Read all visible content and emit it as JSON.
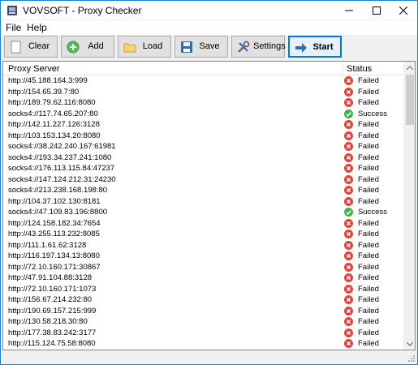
{
  "window": {
    "title": "VOVSOFT - Proxy Checker"
  },
  "menu": {
    "items": [
      "File",
      "Help"
    ]
  },
  "toolbar": {
    "clear_label": "Clear",
    "add_label": "Add",
    "load_label": "Load",
    "save_label": "Save",
    "settings_label": "Settings",
    "start_label": "Start"
  },
  "grid": {
    "headers": {
      "proxy": "Proxy Server",
      "status": "Status"
    },
    "rows": [
      {
        "proxy": "http://45.188.164.3:999",
        "status": "Failed"
      },
      {
        "proxy": "http://154.65.39.7:80",
        "status": "Failed"
      },
      {
        "proxy": "http://189.79.62.116:8080",
        "status": "Failed"
      },
      {
        "proxy": "socks4://117.74.65.207:80",
        "status": "Success"
      },
      {
        "proxy": "http://142.11.227.126:3128",
        "status": "Failed"
      },
      {
        "proxy": "http://103.153.134.20:8080",
        "status": "Failed"
      },
      {
        "proxy": "socks4://38.242.240.167:61981",
        "status": "Failed"
      },
      {
        "proxy": "socks4://193.34.237.241:1080",
        "status": "Failed"
      },
      {
        "proxy": "socks4://176.113.115.84:47237",
        "status": "Failed"
      },
      {
        "proxy": "socks4://147.124.212.31:24230",
        "status": "Failed"
      },
      {
        "proxy": "socks4://213.238.168.198:80",
        "status": "Failed"
      },
      {
        "proxy": "http://104.37.102.130:8181",
        "status": "Failed"
      },
      {
        "proxy": "socks4://47.109.83.196:8800",
        "status": "Success"
      },
      {
        "proxy": "http://124.158.182.34:7654",
        "status": "Failed"
      },
      {
        "proxy": "http://43.255.113.232:8085",
        "status": "Failed"
      },
      {
        "proxy": "http://111.1.61.62:3128",
        "status": "Failed"
      },
      {
        "proxy": "http://116.197.134.13:8080",
        "status": "Failed"
      },
      {
        "proxy": "http://72.10.160.171:30867",
        "status": "Failed"
      },
      {
        "proxy": "http://47.91.104.88:3128",
        "status": "Failed"
      },
      {
        "proxy": "http://72.10.160.171:1073",
        "status": "Failed"
      },
      {
        "proxy": "http://156.67.214.232:80",
        "status": "Failed"
      },
      {
        "proxy": "http://190.69.157.215:999",
        "status": "Failed"
      },
      {
        "proxy": "http://130.58.218.30:80",
        "status": "Failed"
      },
      {
        "proxy": "http://177.38.83.242:3177",
        "status": "Failed"
      },
      {
        "proxy": "http://115.124.75.58:8080",
        "status": "Failed"
      }
    ]
  },
  "colors": {
    "failed": "#e0443e",
    "success": "#3bb54a",
    "accent": "#0078d7"
  },
  "icons": {
    "failed": "x-circle-icon",
    "success": "check-circle-icon"
  }
}
